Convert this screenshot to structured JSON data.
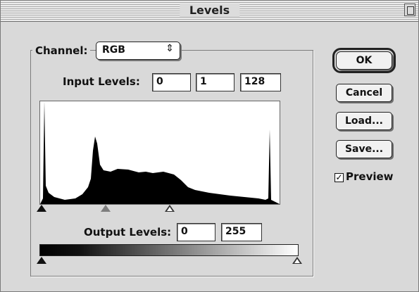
{
  "window": {
    "title": "Levels"
  },
  "channel": {
    "label": "Channel:",
    "value": "RGB",
    "arrows": "⇕"
  },
  "input_levels": {
    "label": "Input Levels:",
    "black": "0",
    "gamma": "1",
    "white": "128"
  },
  "output_levels": {
    "label": "Output Levels:",
    "black": "0",
    "white": "255"
  },
  "buttons": {
    "ok": "OK",
    "cancel": "Cancel",
    "load": "Load...",
    "save": "Save..."
  },
  "preview": {
    "label": "Preview",
    "checked": true,
    "check_glyph": "✓"
  }
}
